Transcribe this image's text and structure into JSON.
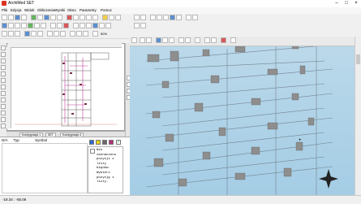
{
  "window": {
    "title": "ArchiMed SET"
  },
  "menu": [
    "Plik",
    "Edycja",
    "Widok",
    "Obliczenia",
    "Wyniki",
    "Okno",
    "Parametry",
    "Pomoc"
  ],
  "toolbar3": {
    "zoom": "50%"
  },
  "tabs": [
    "Kondygnacja 1",
    "SET",
    "Kondygnacja 4"
  ],
  "bottom": {
    "header_col1": "D/A",
    "header_col2": "Typ",
    "header_col3": "Symbol",
    "info_text": "Nie zaznaczono pozycji z listy błędów. Wybierz pozycję z listy."
  },
  "status": {
    "coords": "-18.34 : -55.06"
  },
  "colors": {
    "sky_top": "#bcd9ea",
    "sky_bottom": "#a4cde5"
  }
}
